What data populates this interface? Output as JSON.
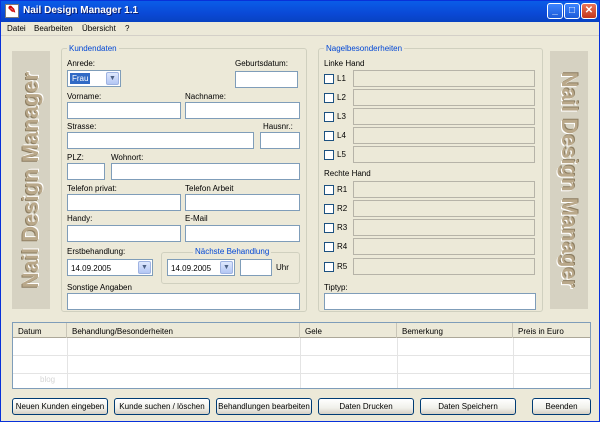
{
  "window": {
    "title": "Nail Design Manager 1.1",
    "app_icon_glyph": "✎"
  },
  "titlebar_buttons": {
    "minimize": "_",
    "maximize": "□",
    "close": "✕"
  },
  "menu": [
    "Datei",
    "Bearbeiten",
    "Übersicht",
    "?"
  ],
  "side_banner": "Nail Design Manager",
  "kunden": {
    "title": "Kundendaten",
    "anrede_label": "Anrede:",
    "anrede_value": "Frau",
    "geburtsdatum_label": "Geburtsdatum:",
    "vorname_label": "Vorname:",
    "nachname_label": "Nachname:",
    "strasse_label": "Strasse:",
    "hausnr_label": "Hausnr.:",
    "plz_label": "PLZ:",
    "wohnort_label": "Wohnort:",
    "telefon_privat_label": "Telefon privat:",
    "telefon_arbeit_label": "Telefon Arbeit",
    "handy_label": "Handy:",
    "email_label": "E-Mail",
    "erstbehandlung_label": "Erstbehandlung:",
    "erstbehandlung_value": "14.09.2005",
    "naechste_title": "Nächste Behandlung",
    "naechste_value": "14.09.2005",
    "uhr_label": "Uhr",
    "sonstige_label": "Sonstige Angaben"
  },
  "nagel": {
    "title": "Nagelbesonderheiten",
    "linke_label": "Linke Hand",
    "linke": [
      "L1",
      "L2",
      "L3",
      "L4",
      "L5"
    ],
    "rechte_label": "Rechte Hand",
    "rechte": [
      "R1",
      "R2",
      "R3",
      "R4",
      "R5"
    ],
    "tiptyp_label": "Tiptyp:"
  },
  "table": {
    "columns": [
      "Datum",
      "Behandlung/Besonderheiten",
      "Gele",
      "Bemerkung",
      "Preis in Euro"
    ],
    "watermark": "blog"
  },
  "buttons": {
    "neuer_kunde": "Neuen Kunden eingeben",
    "suchen": "Kunde suchen / löschen",
    "behandlungen": "Behandlungen bearbeiten",
    "drucken": "Daten Drucken",
    "speichern": "Daten Speichern",
    "beenden": "Beenden"
  }
}
